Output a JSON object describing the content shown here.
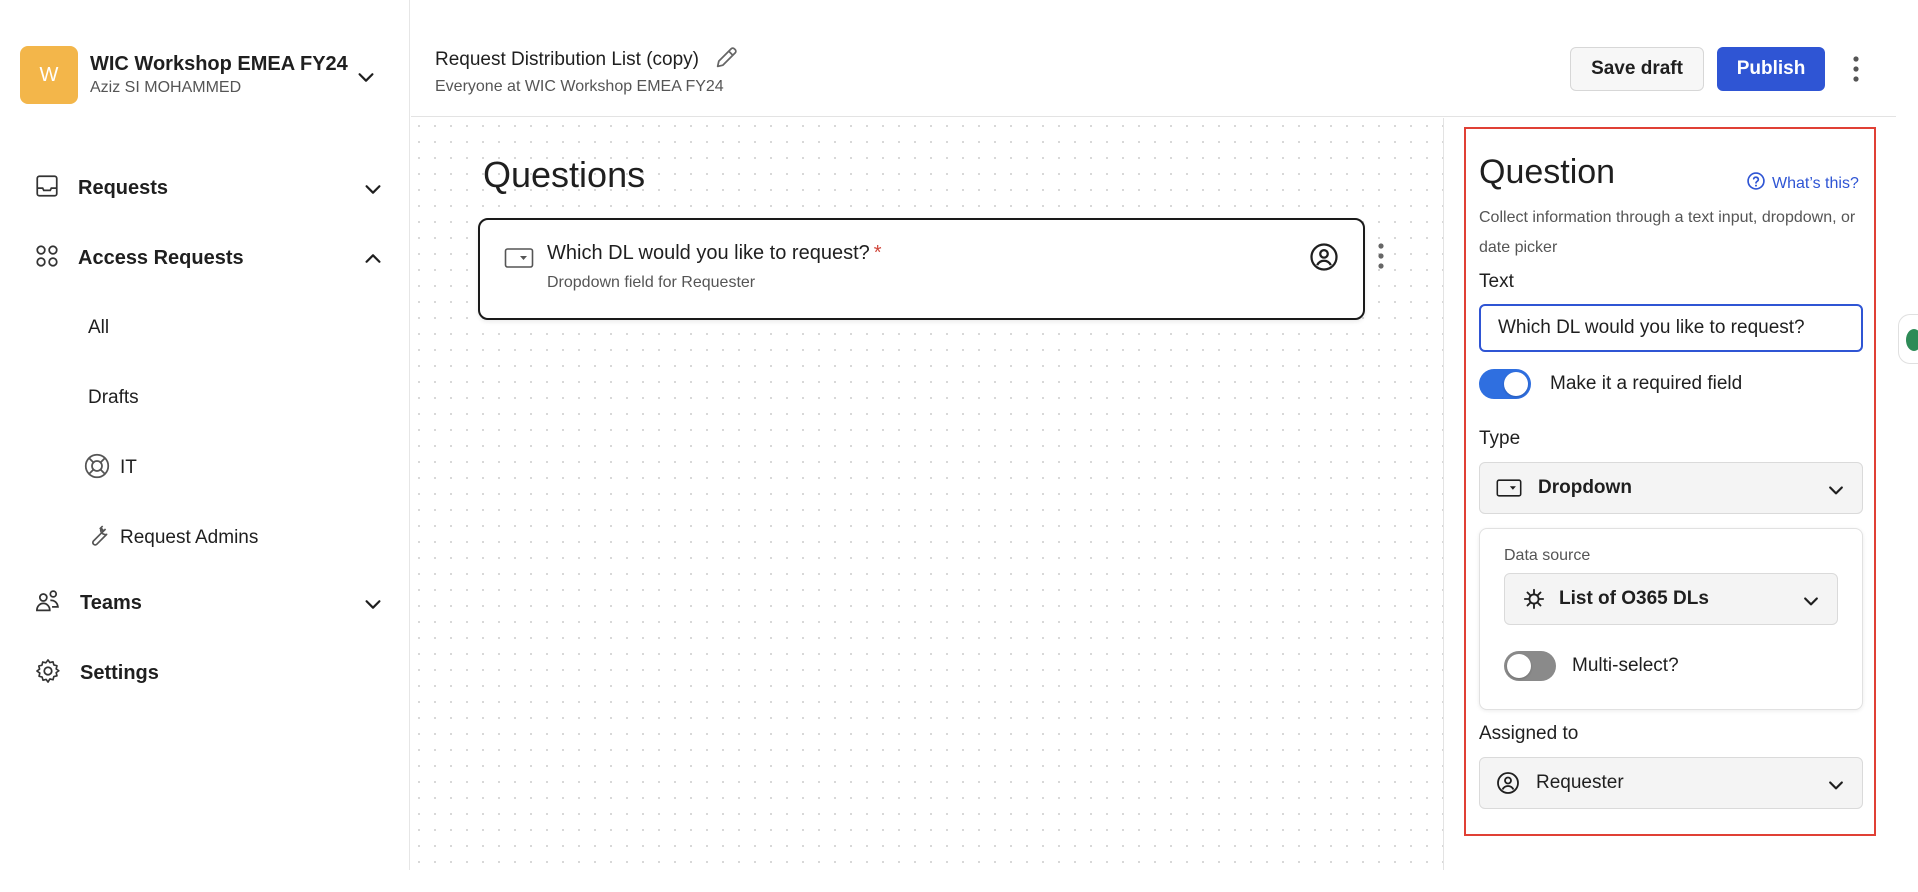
{
  "workspace": {
    "initial": "W",
    "name": "WIC Workshop EMEA FY24",
    "user": "Aziz SI MOHAMMED",
    "avatar_color": "#f3b64a"
  },
  "sidebar": {
    "items": [
      {
        "label": "Requests",
        "icon": "inbox-icon",
        "expanded": false
      },
      {
        "label": "Access Requests",
        "icon": "apps-grid-icon",
        "expanded": true
      },
      {
        "label": "Teams",
        "icon": "people-icon",
        "expanded": false
      },
      {
        "label": "Settings",
        "icon": "gear-icon"
      }
    ],
    "sub_items": [
      {
        "label": "All"
      },
      {
        "label": "Drafts"
      },
      {
        "label": "IT",
        "icon": "lifebuoy-icon"
      },
      {
        "label": "Request Admins",
        "icon": "wrench-icon"
      }
    ]
  },
  "header": {
    "title": "Request Distribution List (copy)",
    "subtitle": "Everyone at WIC Workshop EMEA FY24",
    "save_label": "Save draft",
    "publish_label": "Publish",
    "accent": "#2f55d4"
  },
  "canvas": {
    "heading": "Questions",
    "question": {
      "text": "Which DL would you like to request?",
      "required_mark": "*",
      "subtitle": "Dropdown field for Requester"
    }
  },
  "panel": {
    "title": "Question",
    "help": "What’s this?",
    "description": "Collect information through a text input, dropdown, or date picker",
    "text_label": "Text",
    "text_value": "Which DL would you like to request?",
    "required_label": "Make it a required field",
    "required_on": true,
    "type_label": "Type",
    "type_value": "Dropdown",
    "data_source_label": "Data source",
    "data_source_value": "List of O365 DLs",
    "multi_label": "Multi-select?",
    "multi_on": false,
    "assigned_label": "Assigned to",
    "assigned_value": "Requester",
    "highlight_color": "#e04035"
  }
}
